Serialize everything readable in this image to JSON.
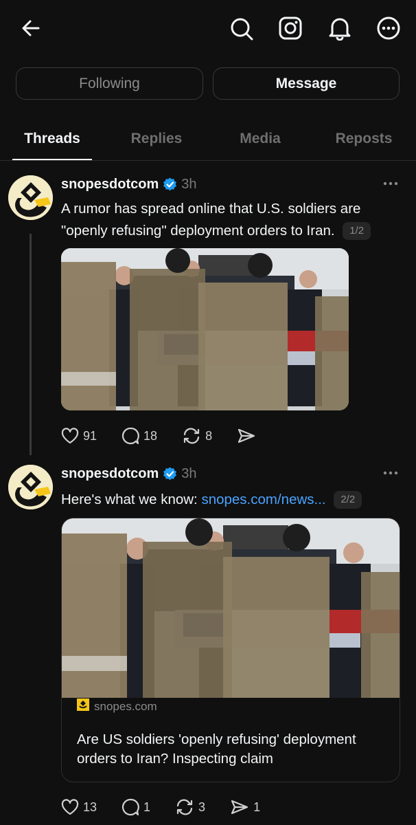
{
  "topbar": {
    "back_icon": "arrow-left-icon",
    "icons": [
      "search-icon",
      "instagram-icon",
      "bell-icon",
      "more-circle-icon"
    ]
  },
  "profile_buttons": {
    "following": "Following",
    "message": "Message"
  },
  "tabs": [
    "Threads",
    "Replies",
    "Media",
    "Reposts"
  ],
  "active_tab": "Threads",
  "posts": [
    {
      "username": "snopesdotcom",
      "time": "3h",
      "text": "A rumor has spread online that U.S. soldiers are \"openly refusing\" deployment orders to Iran.",
      "pager": "1/2",
      "stats": {
        "likes": "91",
        "replies": "18",
        "reposts": "8"
      }
    },
    {
      "username": "snopesdotcom",
      "time": "3h",
      "text_prefix": "Here's what we know: ",
      "link_text": "snopes.com/news...",
      "pager": "2/2",
      "link_card": {
        "domain": "snopes.com",
        "title": "Are US soldiers 'openly refusing' deployment orders to Iran? Inspecting claim"
      },
      "stats": {
        "likes": "13",
        "replies": "1",
        "reposts": "3",
        "shares": "1"
      }
    }
  ],
  "colors": {
    "background": "#101010",
    "text": "#f3f5f7",
    "muted": "#7a7a7a",
    "link": "#4aa3ff",
    "verified": "#1d9bf0",
    "brand_yellow": "#f5c518"
  }
}
